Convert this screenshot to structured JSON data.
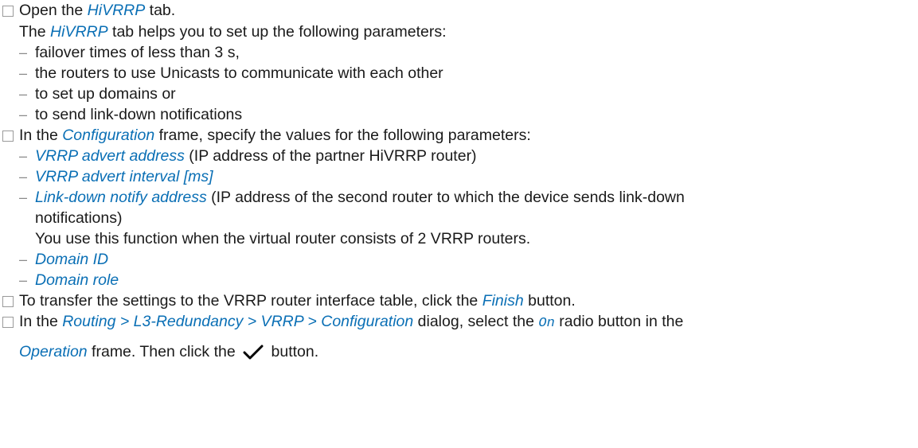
{
  "steps": [
    {
      "intro": "Open the ",
      "ui": "HiVRRP",
      "after": " tab.",
      "desc_pre": "The ",
      "desc_ui": "HiVRRP",
      "desc_post": " tab helps you to set up the following parameters:",
      "items": [
        "failover times of less than 3 s,",
        "the routers to use Unicasts to communicate with each other",
        "to set up domains or",
        "to send link-down notifications"
      ]
    },
    {
      "pre": "In the ",
      "ui": "Configuration",
      "post": " frame, specify the values for the following parameters:",
      "params": [
        {
          "ui": "VRRP advert address",
          "text": " (IP address of the partner HiVRRP router)"
        },
        {
          "ui": "VRRP advert interval [ms]",
          "text": ""
        },
        {
          "ui": "Link-down notify address",
          "text": " (IP address of the second router to which the device sends link-down",
          "cont": "notifications)",
          "note": "You use this function when the virtual router consists of 2 VRRP routers."
        },
        {
          "ui": "Domain ID",
          "text": ""
        },
        {
          "ui": "Domain role",
          "text": ""
        }
      ]
    },
    {
      "pre": "To transfer the settings to the VRRP router interface table, click the ",
      "ui": "Finish",
      "post": " button."
    },
    {
      "pre": "In the ",
      "ui": "Routing > L3-Redundancy > VRRP > Configuration",
      "mid": " dialog, select the ",
      "mono": "On",
      "post": " radio button in the",
      "line2_ui": "Operation",
      "line2_mid": " frame. Then click the ",
      "line2_post": " button."
    }
  ],
  "dash_char": "–",
  "accent_color": "#0a6fb5",
  "icons": {
    "checkbox": "checkbox-icon",
    "apply": "checkmark-icon"
  }
}
